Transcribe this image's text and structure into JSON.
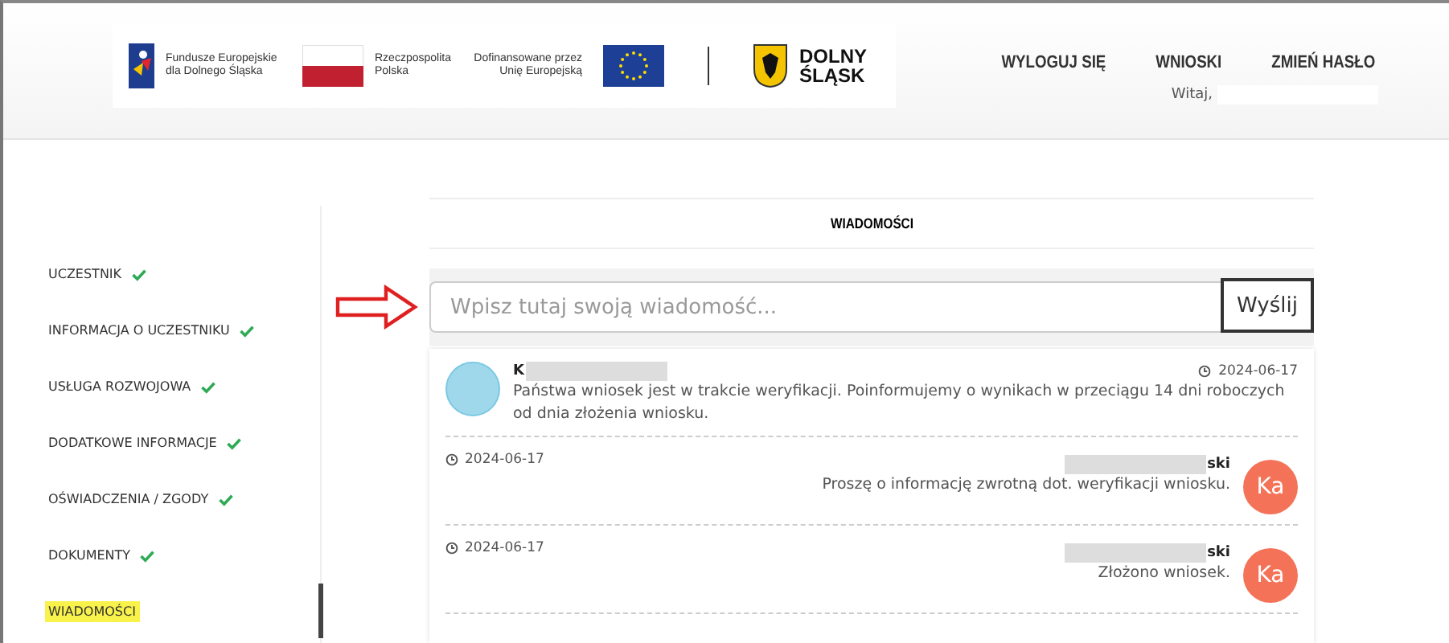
{
  "header": {
    "logos": {
      "funds": "Fundusze Europejskie dla Dolnego Śląska",
      "poland": "Rzeczpospolita Polska",
      "eu": "Dofinansowane przez Unię Europejską",
      "region": "DOLNY ŚLĄSK"
    },
    "nav": [
      "WYLOGUJ SIĘ",
      "WNIOSKI",
      "ZMIEŃ HASŁO"
    ],
    "greeting": "Witaj,"
  },
  "sidebar": {
    "items": [
      {
        "label": "UCZESTNIK",
        "done": true,
        "selected": false
      },
      {
        "label": "INFORMACJA O UCZESTNIKU",
        "done": true,
        "selected": false
      },
      {
        "label": "USŁUGA ROZWOJOWA",
        "done": true,
        "selected": false
      },
      {
        "label": "DODATKOWE INFORMACJE",
        "done": true,
        "selected": false
      },
      {
        "label": "OŚWIADCZENIA / ZGODY",
        "done": true,
        "selected": false
      },
      {
        "label": "DOKUMENTY",
        "done": true,
        "selected": false
      },
      {
        "label": "WIADOMOŚCI",
        "done": false,
        "selected": true
      }
    ]
  },
  "main": {
    "title": "WIADOMOŚCI",
    "composer": {
      "placeholder": "Wpisz tutaj swoją wiadomość...",
      "button": "Wyślij"
    },
    "messages": [
      {
        "kind": "incoming",
        "author": "K",
        "date": "2024-06-17",
        "text": "Państwa wniosek jest w trakcie weryfikacji. Poinformujemy o wynikach w przeciągu 14 dni roboczych od dnia złożenia wniosku.",
        "color": "#9ed8ea"
      },
      {
        "kind": "outgoing",
        "author": "ski",
        "date": "2024-06-17",
        "text": "Proszę o informację zwrotną dot. weryfikacji wniosku.",
        "avatar": "Ka",
        "color": "#f47358"
      },
      {
        "kind": "outgoing",
        "author": "ski",
        "date": "2024-06-17",
        "text": "Złożono wniosek.",
        "avatar": "Ka",
        "color": "#f47358"
      }
    ]
  }
}
